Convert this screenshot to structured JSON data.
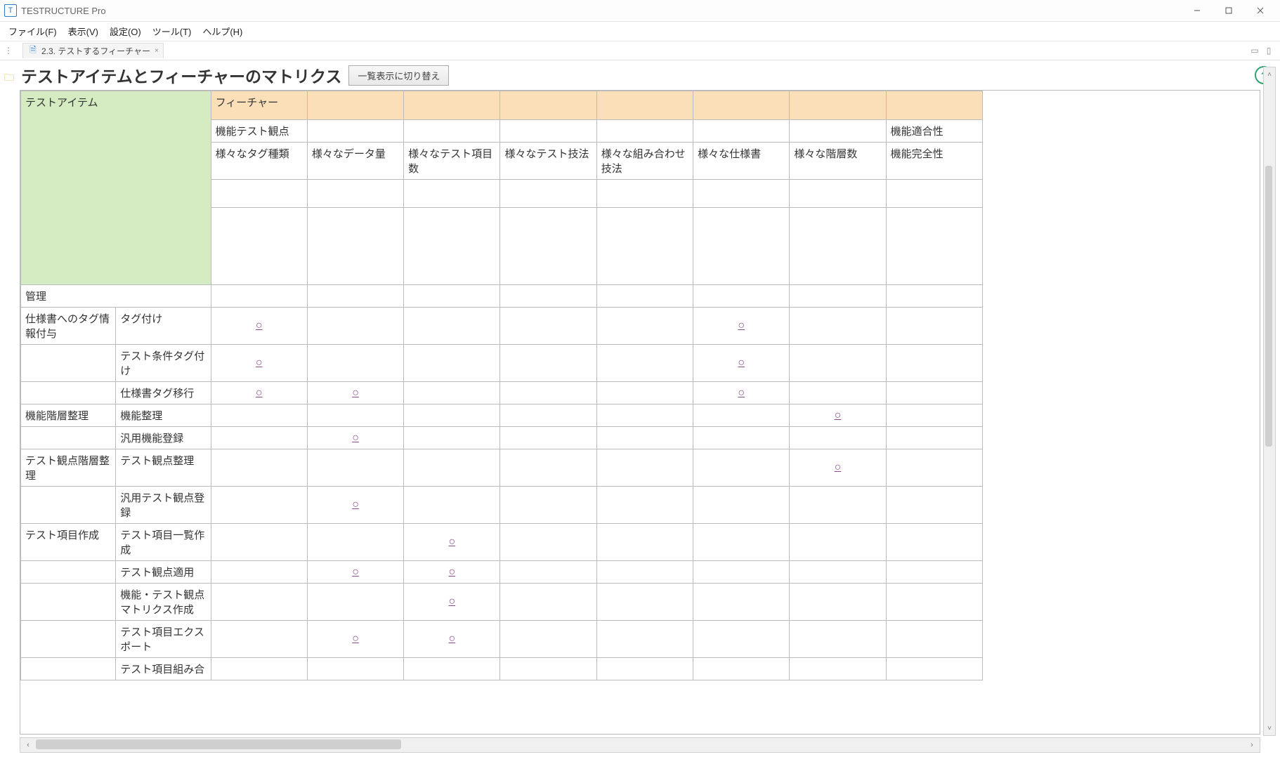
{
  "app_title": "TESTRUCTURE Pro",
  "menu": [
    "ファイル(F)",
    "表示(V)",
    "設定(O)",
    "ツール(T)",
    "ヘルプ(H)"
  ],
  "tab": {
    "label": "2.3. テストするフィーチャー",
    "close": "×"
  },
  "page_title": "テストアイテムとフィーチャーのマトリクス",
  "toggle_view": "一覧表示に切り替え",
  "headers": {
    "test_item_label": "テストアイテム",
    "feature_label": "フィーチャー",
    "row2": {
      "col1": "機能テスト観点",
      "col8": "機能適合性"
    },
    "row3": [
      "様々なタグ種類",
      "様々なデータ量",
      "様々なテスト項目数",
      "様々なテスト技法",
      "様々な組み合わせ技法",
      "様々な仕様書",
      "様々な階層数",
      "機能完全性"
    ]
  },
  "rows": [
    {
      "cat": "管理",
      "sub": "",
      "marks": [
        "",
        "",
        "",
        "",
        "",
        "",
        "",
        ""
      ]
    },
    {
      "cat": "仕様書へのタグ情報付与",
      "sub": "タグ付け",
      "marks": [
        "○",
        "",
        "",
        "",
        "",
        "○",
        "",
        ""
      ]
    },
    {
      "cat": "",
      "sub": "テスト条件タグ付け",
      "marks": [
        "○",
        "",
        "",
        "",
        "",
        "○",
        "",
        ""
      ]
    },
    {
      "cat": "",
      "sub": "仕様書タグ移行",
      "marks": [
        "○",
        "○",
        "",
        "",
        "",
        "○",
        "",
        ""
      ]
    },
    {
      "cat": "機能階層整理",
      "sub": "機能整理",
      "marks": [
        "",
        "",
        "",
        "",
        "",
        "",
        "○",
        ""
      ]
    },
    {
      "cat": "",
      "sub": "汎用機能登録",
      "marks": [
        "",
        "○",
        "",
        "",
        "",
        "",
        "",
        ""
      ]
    },
    {
      "cat": "テスト観点階層整理",
      "sub": "テスト観点整理",
      "marks": [
        "",
        "",
        "",
        "",
        "",
        "",
        "○",
        ""
      ]
    },
    {
      "cat": "",
      "sub": "汎用テスト観点登録",
      "marks": [
        "",
        "○",
        "",
        "",
        "",
        "",
        "",
        ""
      ]
    },
    {
      "cat": "テスト項目作成",
      "sub": "テスト項目一覧作成",
      "marks": [
        "",
        "",
        "○",
        "",
        "",
        "",
        "",
        ""
      ]
    },
    {
      "cat": "",
      "sub": "テスト観点適用",
      "marks": [
        "",
        "○",
        "○",
        "",
        "",
        "",
        "",
        ""
      ]
    },
    {
      "cat": "",
      "sub": "機能・テスト観点マトリクス作成",
      "marks": [
        "",
        "",
        "○",
        "",
        "",
        "",
        "",
        ""
      ]
    },
    {
      "cat": "",
      "sub": "テスト項目エクスポート",
      "marks": [
        "",
        "○",
        "○",
        "",
        "",
        "",
        "",
        ""
      ]
    },
    {
      "cat": "",
      "sub": "テスト項目組み合",
      "marks": [
        "",
        "",
        "",
        "",
        "",
        "",
        "",
        ""
      ]
    }
  ],
  "mark_symbol": "○"
}
